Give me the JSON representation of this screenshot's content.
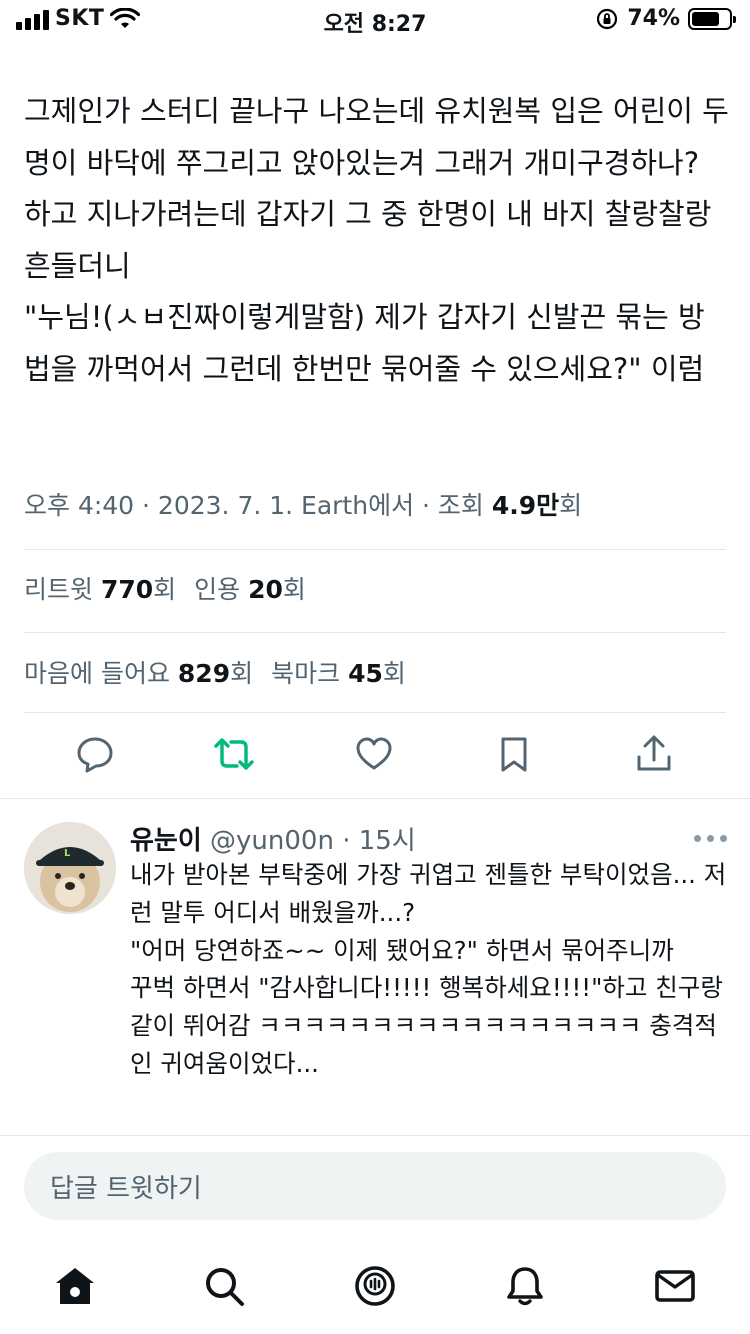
{
  "status_bar": {
    "carrier": "SKT",
    "time": "오전 8:27",
    "battery_percent": "74%",
    "battery_level": 0.74
  },
  "tweet": {
    "text": "그제인가 스터디 끝나구 나오는데 유치원복 입은 어린이 두명이 바닥에 쭈그리고 앉아있는겨 그래거 개미구경하나? 하고 지나가려는데 갑자기 그 중 한명이 내 바지 찰랑찰랑 흔들더니\n\"누님!(ㅅㅂ진짜이렇게말함) 제가 갑자기 신발끈 묶는 방법을 까먹어서 그런데 한번만 묶어줄 수 있으세요?\" 이럼",
    "meta_prefix": "오후 4:40 · 2023. 7. 1. Earth에서 · 조회 ",
    "views": "4.9만",
    "views_suffix": "회"
  },
  "stats": {
    "retweets_label": "리트윗 ",
    "retweets": "770",
    "retweets_suffix": "회",
    "quotes_label": "인용 ",
    "quotes": "20",
    "quotes_suffix": "회",
    "likes_label": "마음에 들어요 ",
    "likes": "829",
    "likes_suffix": "회",
    "bookmarks_label": "북마크 ",
    "bookmarks": "45",
    "bookmarks_suffix": "회"
  },
  "actions": {
    "reply_icon": "speech-bubble-icon",
    "retweet_icon": "retweet-icon",
    "retweet_color": "#00ba7c",
    "like_icon": "heart-icon",
    "bookmark_icon": "bookmark-icon",
    "share_icon": "share-icon"
  },
  "reply": {
    "name": "유눈이",
    "handle": " @yun00n · 15시",
    "text": "내가 받아본 부탁중에 가장 귀엽고 젠틀한 부탁이었음... 저런 말투 어디서 배웠을까...?\n\"어머 당연하죠~~ 이제 됐어요?\" 하면서 묶어주니까\n꾸벅 하면서 \"감사합니다!!!!! 행복하세요!!!!\"하고 친구랑 같이 뛰어감 ㅋㅋㅋㅋㅋㅋㅋㅋㅋㅋㅋㅋㅋㅋㅋㅋㅋ 충격적인 귀여움이었다..."
  },
  "reply_input": {
    "placeholder": "답글 트윗하기"
  },
  "bottom_nav": [
    "home-icon",
    "search-icon",
    "spaces-icon",
    "notifications-bell-icon",
    "messages-envelope-icon"
  ]
}
